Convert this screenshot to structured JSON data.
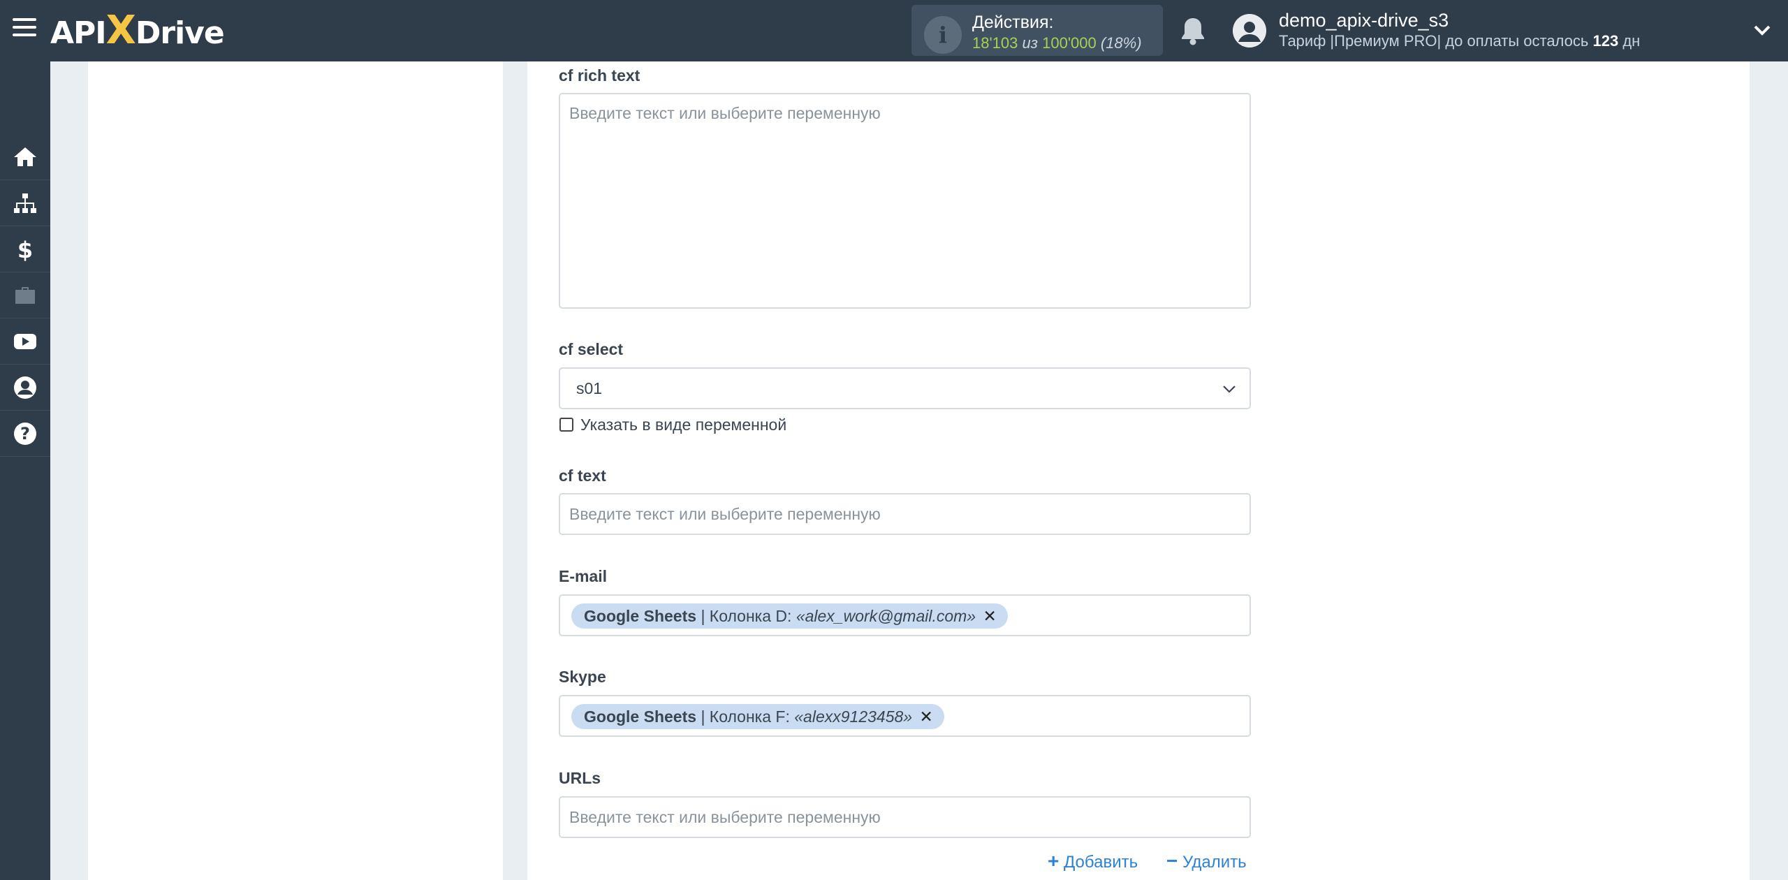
{
  "header": {
    "logo": {
      "left": "API",
      "x": "X",
      "right": "Drive"
    },
    "actions": {
      "title": "Действия:",
      "used": "18'103",
      "of": "из",
      "total": "100'000",
      "percent": "(18%)"
    },
    "user": {
      "name": "demo_apix-drive_s3",
      "plan_prefix": "Тариф |Премиум PRO| до оплаты осталось",
      "days": "123",
      "days_unit": "дн"
    }
  },
  "sidebar": {
    "items": [
      {
        "name": "home-icon"
      },
      {
        "name": "sitemap-icon"
      },
      {
        "name": "dollar-icon"
      },
      {
        "name": "briefcase-icon"
      },
      {
        "name": "youtube-icon"
      },
      {
        "name": "user-circle-icon"
      },
      {
        "name": "question-circle-icon"
      }
    ]
  },
  "form": {
    "cf_rich_text": {
      "label": "cf rich text",
      "placeholder": "Введите текст или выберите переменную"
    },
    "cf_select": {
      "label": "cf select",
      "value": "s01",
      "checkbox_label": "Указать в виде переменной"
    },
    "cf_text": {
      "label": "cf text",
      "placeholder": "Введите текст или выберите переменную"
    },
    "email": {
      "label": "E-mail",
      "tag": {
        "source": "Google Sheets",
        "column": "| Колонка D:",
        "value": "«alex_work@gmail.com»"
      }
    },
    "skype": {
      "label": "Skype",
      "tag": {
        "source": "Google Sheets",
        "column": "| Колонка F:",
        "value": "«alexx9123458»"
      }
    },
    "urls": {
      "label": "URLs",
      "placeholder": "Введите текст или выберите переменную"
    },
    "add_label": "Добавить",
    "remove_label": "Удалить"
  },
  "colors": {
    "topbar": "#2f3d4b",
    "accent_yellow": "#f6c543",
    "green": "#a7d155",
    "tag_bg": "#c9dcf2",
    "link": "#2c82d6"
  }
}
